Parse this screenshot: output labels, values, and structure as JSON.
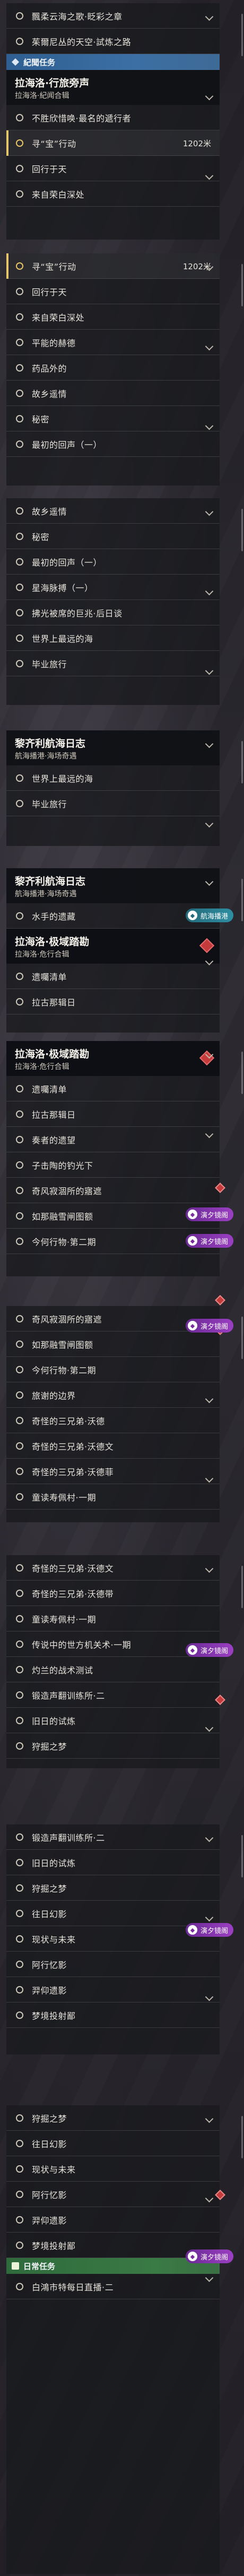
{
  "slabs": [
    {
      "rows": [
        {
          "type": "task",
          "label": "飄柔云海之歌·眨彩之章"
        },
        {
          "type": "task",
          "label": "茱爾尼丛的天空·試炼之路"
        },
        {
          "type": "section",
          "label": "紀聞任务"
        },
        {
          "type": "header",
          "title": "拉海洛·行旅旁声",
          "sub": "拉海洛·紀闻合辑"
        },
        {
          "type": "task",
          "label": "不胜欣惜唤·最名的遞行者"
        },
        {
          "type": "task",
          "label": "寻“宝”行动",
          "count": "1202米",
          "selected": true
        },
        {
          "type": "task",
          "label": "回行于天"
        },
        {
          "type": "task",
          "label": "来自荣白深处"
        }
      ]
    },
    {
      "rows": [
        {
          "type": "task",
          "label": "寻“宝”行动",
          "count": "1202米",
          "selected": true
        },
        {
          "type": "task",
          "label": "回行于天"
        },
        {
          "type": "task",
          "label": "来自荣白深处"
        },
        {
          "type": "task",
          "label": "平能的赫德"
        },
        {
          "type": "task",
          "label": "药品外的"
        },
        {
          "type": "task",
          "label": "故乡遥情"
        },
        {
          "type": "task",
          "label": "秘密"
        },
        {
          "type": "task",
          "label": "最初的回声（一）"
        }
      ]
    },
    {
      "rows": [
        {
          "type": "task",
          "label": "故乡遥情"
        },
        {
          "type": "task",
          "label": "秘密"
        },
        {
          "type": "task",
          "label": "最初的回声（一）"
        },
        {
          "type": "task",
          "label": "星海脉搏（一）"
        },
        {
          "type": "task",
          "label": "拂光被席的巨兆·后日谈"
        },
        {
          "type": "task",
          "label": "世界上最远的海"
        },
        {
          "type": "task",
          "label": "毕业旅行"
        }
      ]
    },
    {
      "rows": [
        {
          "type": "header",
          "title": "黎齐利航海日志",
          "sub": "航海播港·海场奇遇"
        },
        {
          "type": "task",
          "label": "世界上最远的海"
        },
        {
          "type": "task",
          "label": "毕业旅行"
        }
      ]
    },
    {
      "rows": [
        {
          "type": "header",
          "title": "黎齐利航海日志",
          "sub": "航海播港·海场奇遇"
        },
        {
          "type": "task",
          "label": "水手的遗藏"
        },
        {
          "type": "header",
          "title": "拉海洛·极域踏勘",
          "sub": "拉海洛·危行合辑",
          "alt": true
        },
        {
          "type": "task",
          "label": "遗囑清单"
        },
        {
          "type": "task",
          "label": "拉古那辑日"
        }
      ]
    },
    {
      "rows": [
        {
          "type": "header",
          "title": "拉海洛·极域踏勘",
          "sub": "拉海洛·危行合辑",
          "alt": true
        },
        {
          "type": "task",
          "label": "遗囑清单"
        },
        {
          "type": "task",
          "label": "拉古那辑日"
        },
        {
          "type": "task",
          "label": "奏者的遗望"
        },
        {
          "type": "task",
          "label": "子击陶的钓光下"
        },
        {
          "type": "task",
          "label": "奇风寂涸所的寤遮"
        },
        {
          "type": "task",
          "label": "如那融雪闸图额"
        },
        {
          "type": "task",
          "label": "今何行物·第二期"
        }
      ]
    },
    {
      "rows": [
        {
          "type": "task",
          "label": "奇风寂涸所的寤遮"
        },
        {
          "type": "task",
          "label": "如那融雪闸图额"
        },
        {
          "type": "task",
          "label": "今何行物·第二期"
        },
        {
          "type": "task",
          "label": "旅谢的边界"
        },
        {
          "type": "task",
          "label": "奇怪的三兄弟·沃德"
        },
        {
          "type": "task",
          "label": "奇怪的三兄弟·沃德文"
        },
        {
          "type": "task",
          "label": "奇怪的三兄弟·沃德菲"
        },
        {
          "type": "task",
          "label": "童读寿佩村·一期"
        }
      ]
    },
    {
      "rows": [
        {
          "type": "task",
          "label": "奇怪的三兄弟·沃德文"
        },
        {
          "type": "task",
          "label": "奇怪的三兄弟·沃德带"
        },
        {
          "type": "task",
          "label": "童读寿佩村·一期"
        },
        {
          "type": "task",
          "label": "传说中的世方机关术·一期"
        },
        {
          "type": "task",
          "label": "灼兰的战术测试"
        },
        {
          "type": "task",
          "label": "锻造声翻训练所·二"
        },
        {
          "type": "task",
          "label": "旧日的试炼"
        },
        {
          "type": "task",
          "label": "狩掘之梦"
        }
      ]
    },
    {
      "rows": [
        {
          "type": "task",
          "label": "锻造声翻训练所·二"
        },
        {
          "type": "task",
          "label": "旧日的试炼"
        },
        {
          "type": "task",
          "label": "狩掘之梦"
        },
        {
          "type": "task",
          "label": "往日幻影"
        },
        {
          "type": "task",
          "label": "现状与未来"
        },
        {
          "type": "task",
          "label": "阿行忆影"
        },
        {
          "type": "task",
          "label": "羿仰遗影"
        },
        {
          "type": "task",
          "label": "梦境投射鄙"
        }
      ]
    },
    {
      "rows": [
        {
          "type": "task",
          "label": "狩掘之梦"
        },
        {
          "type": "task",
          "label": "往日幻影"
        },
        {
          "type": "task",
          "label": "现状与未来"
        },
        {
          "type": "task",
          "label": "阿行忆影"
        },
        {
          "type": "task",
          "label": "羿仰遗影"
        },
        {
          "type": "task",
          "label": "梦境投射鄙"
        },
        {
          "type": "section",
          "label": "日常任务",
          "daily": true
        },
        {
          "type": "task",
          "label": "白鴻市特每日直播·二"
        }
      ]
    }
  ],
  "badges": [
    {
      "text": "航海播港",
      "style": "teal"
    },
    {
      "text": "演夕镜阁",
      "style": "purple"
    },
    {
      "text": "演夕镜阁",
      "style": "purple"
    },
    {
      "text": "演夕镜阁",
      "style": "purple"
    },
    {
      "text": "演夕镜阁",
      "style": "purple"
    },
    {
      "text": "演夕镜阁",
      "style": "purple"
    },
    {
      "text": "演夕镜阁",
      "style": "purple"
    }
  ],
  "colors": {
    "accent_gold": "#e6c56b",
    "section_blue": "#3c6fa4",
    "section_green": "#3a7a45",
    "gem_red": "#c53a3a",
    "badge_purple": "#9b3fc2"
  }
}
